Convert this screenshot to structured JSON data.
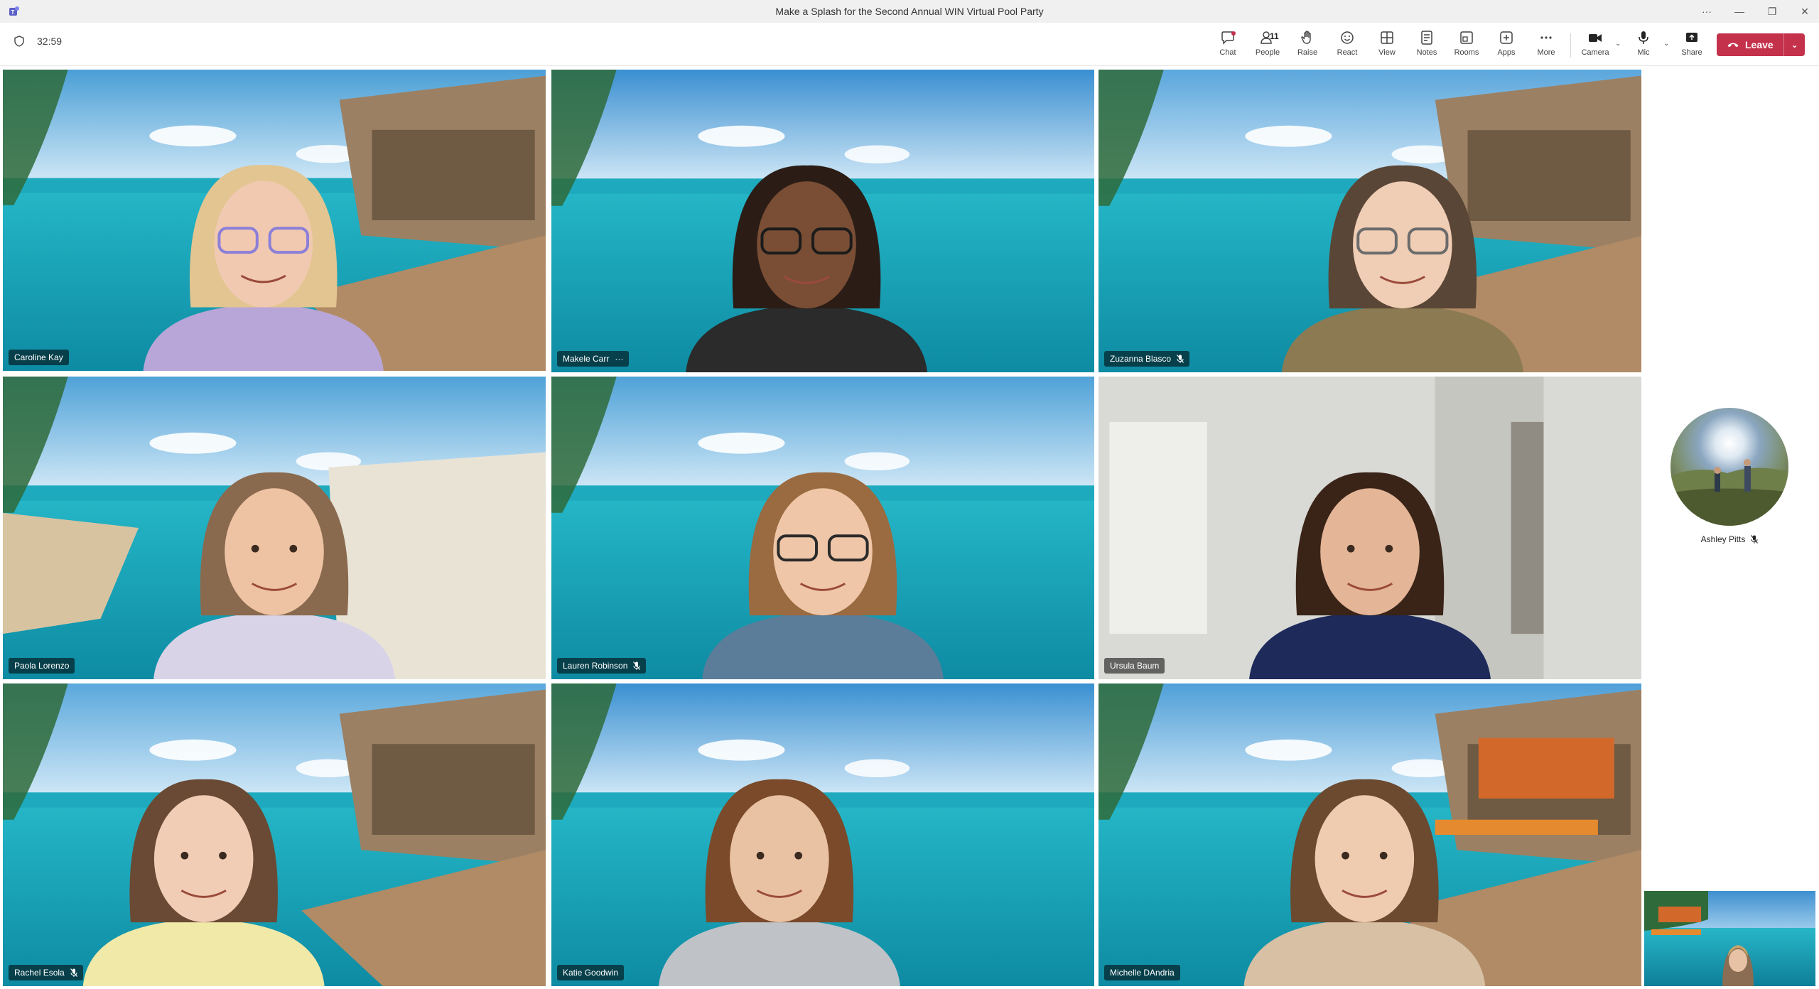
{
  "window": {
    "title": "Make a Splash for the Second Annual WIN Virtual Pool Party",
    "controls": [
      "more-options-icon",
      "minimize-icon",
      "restore-icon",
      "close-icon"
    ]
  },
  "meeting": {
    "timer": "32:59"
  },
  "toolbar": {
    "items": [
      {
        "id": "chat",
        "label": "Chat",
        "icon": "chat-icon",
        "has_notification": true
      },
      {
        "id": "people",
        "label": "People",
        "icon": "people-icon",
        "count": "11"
      },
      {
        "id": "raise",
        "label": "Raise",
        "icon": "hand-icon"
      },
      {
        "id": "react",
        "label": "React",
        "icon": "smiley-icon"
      },
      {
        "id": "view",
        "label": "View",
        "icon": "grid-icon"
      },
      {
        "id": "notes",
        "label": "Notes",
        "icon": "notes-icon"
      },
      {
        "id": "rooms",
        "label": "Rooms",
        "icon": "rooms-icon"
      },
      {
        "id": "apps",
        "label": "Apps",
        "icon": "plus-icon"
      },
      {
        "id": "more",
        "label": "More",
        "icon": "ellipsis-icon"
      },
      {
        "id": "camera",
        "label": "Camera",
        "icon": "camera-icon"
      },
      {
        "id": "mic",
        "label": "Mic",
        "icon": "mic-icon"
      },
      {
        "id": "share",
        "label": "Share",
        "icon": "share-icon"
      }
    ],
    "leave_label": "Leave",
    "leave_color": "#c4314b"
  },
  "participants": [
    {
      "name": "Caroline Kay",
      "muted": false,
      "active": true,
      "more": false
    },
    {
      "name": "Makele Carr",
      "muted": false,
      "active": false,
      "more": true
    },
    {
      "name": "Zuzanna Blasco",
      "muted": true,
      "active": false,
      "more": false
    },
    {
      "name": "Paola Lorenzo",
      "muted": false,
      "active": false,
      "more": false
    },
    {
      "name": "Lauren Robinson",
      "muted": true,
      "active": false,
      "more": false
    },
    {
      "name": "Ursula Baum",
      "muted": false,
      "active": true,
      "more": false
    },
    {
      "name": "Rachel Esola",
      "muted": true,
      "active": false,
      "more": false
    },
    {
      "name": "Katie Goodwin",
      "muted": false,
      "active": false,
      "more": false
    },
    {
      "name": "Michelle DAndria",
      "muted": false,
      "active": false,
      "more": false
    }
  ],
  "rail": {
    "name": "Ashley Pitts",
    "muted": true
  },
  "colors": {
    "accent": "#5b5fc7",
    "leave": "#c4314b",
    "water": "#1fb7c4",
    "sky": "#4aa3d8"
  }
}
